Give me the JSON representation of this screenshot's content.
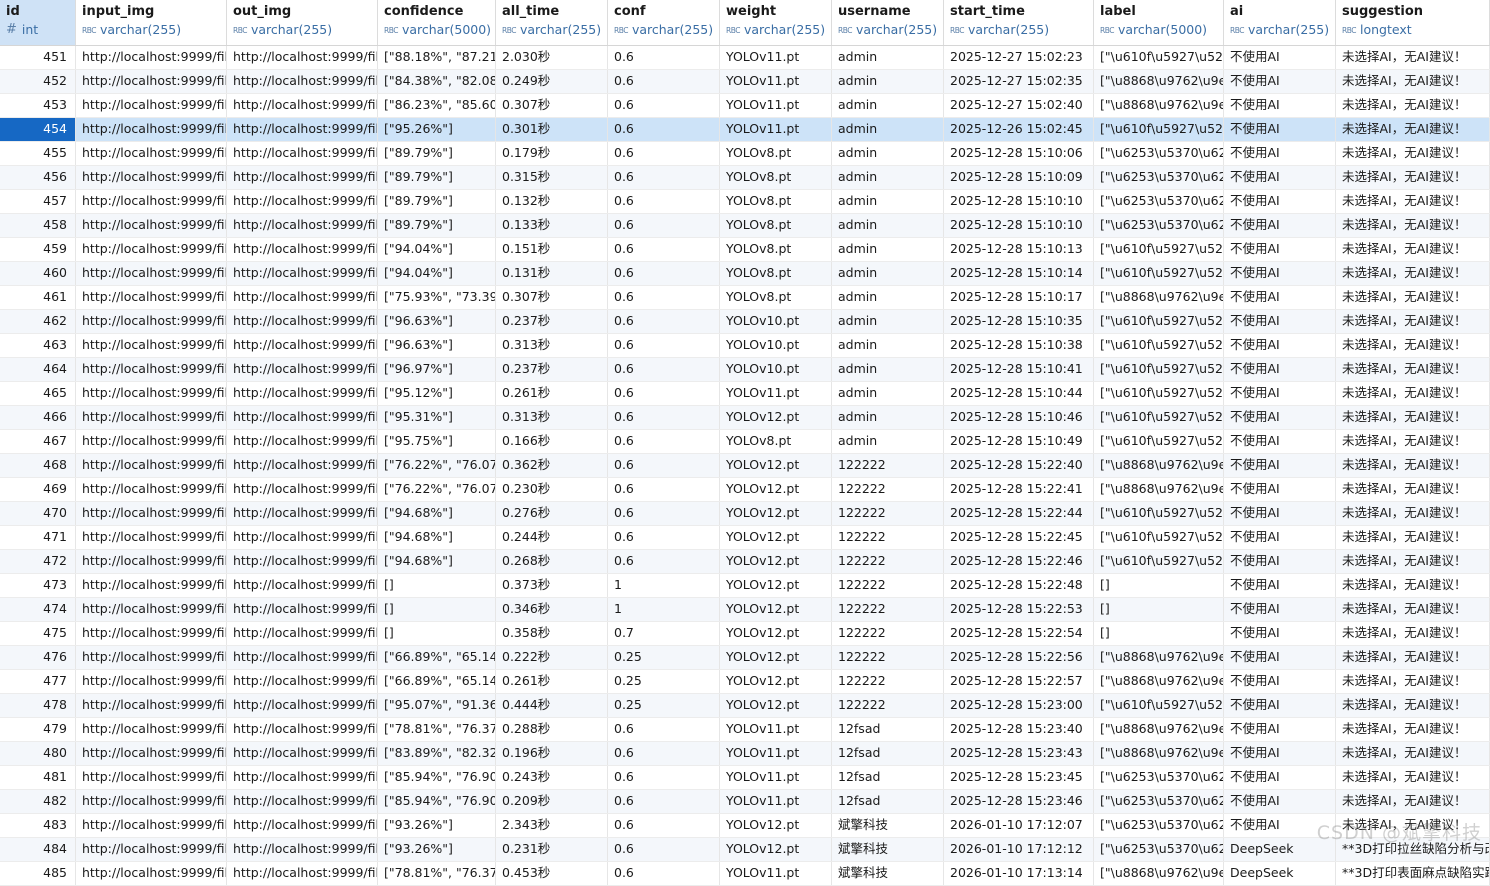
{
  "columns": [
    {
      "name": "id",
      "type": "int",
      "icon": "hash-icon"
    },
    {
      "name": "input_img",
      "type": "varchar(255)",
      "icon": "abc-icon"
    },
    {
      "name": "out_img",
      "type": "varchar(255)",
      "icon": "abc-icon"
    },
    {
      "name": "confidence",
      "type": "varchar(5000)",
      "icon": "abc-icon"
    },
    {
      "name": "all_time",
      "type": "varchar(255)",
      "icon": "abc-icon"
    },
    {
      "name": "conf",
      "type": "varchar(255)",
      "icon": "abc-icon"
    },
    {
      "name": "weight",
      "type": "varchar(255)",
      "icon": "abc-icon"
    },
    {
      "name": "username",
      "type": "varchar(255)",
      "icon": "abc-icon"
    },
    {
      "name": "start_time",
      "type": "varchar(255)",
      "icon": "abc-icon"
    },
    {
      "name": "label",
      "type": "varchar(5000)",
      "icon": "abc-icon"
    },
    {
      "name": "ai",
      "type": "varchar(255)",
      "icon": "abc-icon"
    },
    {
      "name": "suggestion",
      "type": "longtext",
      "icon": "abc-icon"
    }
  ],
  "type_icon_text": "RBC",
  "selected_row": 3,
  "rows": [
    [
      "451",
      "http://localhost:9999/file",
      "http://localhost:9999/file",
      "[\"88.18%\", \"87.21%",
      "2.030秒",
      "0.6",
      "YOLOv11.pt",
      "admin",
      "2025-12-27 15:02:23",
      "[\"\\u610f\\u5927\\u522",
      "不使用AI",
      "未选择AI，无AI建议！"
    ],
    [
      "452",
      "http://localhost:9999/file",
      "http://localhost:9999/file",
      "[\"84.38%\", \"82.08%",
      "0.249秒",
      "0.6",
      "YOLOv11.pt",
      "admin",
      "2025-12-27 15:02:35",
      "[\"\\u8868\\u9762\\u9el",
      "不使用AI",
      "未选择AI，无AI建议！"
    ],
    [
      "453",
      "http://localhost:9999/file",
      "http://localhost:9999/file",
      "[\"86.23%\", \"85.60%",
      "0.307秒",
      "0.6",
      "YOLOv11.pt",
      "admin",
      "2025-12-27 15:02:40",
      "[\"\\u8868\\u9762\\u9el",
      "不使用AI",
      "未选择AI，无AI建议！"
    ],
    [
      "454",
      "http://localhost:9999/file",
      "http://localhost:9999/file",
      "[\"95.26%\"]",
      "0.301秒",
      "0.6",
      "YOLOv11.pt",
      "admin",
      "2025-12-26 15:02:45",
      "[\"\\u610f\\u5927\\u522",
      "不使用AI",
      "未选择AI，无AI建议！"
    ],
    [
      "455",
      "http://localhost:9999/file",
      "http://localhost:9999/file",
      "[\"89.79%\"]",
      "0.179秒",
      "0.6",
      "YOLOv8.pt",
      "admin",
      "2025-12-28 15:10:06",
      "[\"\\u6253\\u5370\\u62c",
      "不使用AI",
      "未选择AI，无AI建议！"
    ],
    [
      "456",
      "http://localhost:9999/file",
      "http://localhost:9999/file",
      "[\"89.79%\"]",
      "0.315秒",
      "0.6",
      "YOLOv8.pt",
      "admin",
      "2025-12-28 15:10:09",
      "[\"\\u6253\\u5370\\u62c",
      "不使用AI",
      "未选择AI，无AI建议！"
    ],
    [
      "457",
      "http://localhost:9999/file",
      "http://localhost:9999/file",
      "[\"89.79%\"]",
      "0.132秒",
      "0.6",
      "YOLOv8.pt",
      "admin",
      "2025-12-28 15:10:10",
      "[\"\\u6253\\u5370\\u62c",
      "不使用AI",
      "未选择AI，无AI建议！"
    ],
    [
      "458",
      "http://localhost:9999/file",
      "http://localhost:9999/file",
      "[\"89.79%\"]",
      "0.133秒",
      "0.6",
      "YOLOv8.pt",
      "admin",
      "2025-12-28 15:10:10",
      "[\"\\u6253\\u5370\\u62c",
      "不使用AI",
      "未选择AI，无AI建议！"
    ],
    [
      "459",
      "http://localhost:9999/file",
      "http://localhost:9999/file",
      "[\"94.04%\"]",
      "0.151秒",
      "0.6",
      "YOLOv8.pt",
      "admin",
      "2025-12-28 15:10:13",
      "[\"\\u610f\\u5927\\u522",
      "不使用AI",
      "未选择AI，无AI建议！"
    ],
    [
      "460",
      "http://localhost:9999/file",
      "http://localhost:9999/file",
      "[\"94.04%\"]",
      "0.131秒",
      "0.6",
      "YOLOv8.pt",
      "admin",
      "2025-12-28 15:10:14",
      "[\"\\u610f\\u5927\\u522",
      "不使用AI",
      "未选择AI，无AI建议！"
    ],
    [
      "461",
      "http://localhost:9999/file",
      "http://localhost:9999/file",
      "[\"75.93%\", \"73.39%",
      "0.307秒",
      "0.6",
      "YOLOv8.pt",
      "admin",
      "2025-12-28 15:10:17",
      "[\"\\u8868\\u9762\\u9el",
      "不使用AI",
      "未选择AI，无AI建议！"
    ],
    [
      "462",
      "http://localhost:9999/file",
      "http://localhost:9999/file",
      "[\"96.63%\"]",
      "0.237秒",
      "0.6",
      "YOLOv10.pt",
      "admin",
      "2025-12-28 15:10:35",
      "[\"\\u610f\\u5927\\u522",
      "不使用AI",
      "未选择AI，无AI建议！"
    ],
    [
      "463",
      "http://localhost:9999/file",
      "http://localhost:9999/file",
      "[\"96.63%\"]",
      "0.313秒",
      "0.6",
      "YOLOv10.pt",
      "admin",
      "2025-12-28 15:10:38",
      "[\"\\u610f\\u5927\\u522",
      "不使用AI",
      "未选择AI，无AI建议！"
    ],
    [
      "464",
      "http://localhost:9999/file",
      "http://localhost:9999/file",
      "[\"96.97%\"]",
      "0.237秒",
      "0.6",
      "YOLOv10.pt",
      "admin",
      "2025-12-28 15:10:41",
      "[\"\\u610f\\u5927\\u522",
      "不使用AI",
      "未选择AI，无AI建议！"
    ],
    [
      "465",
      "http://localhost:9999/file",
      "http://localhost:9999/file",
      "[\"95.12%\"]",
      "0.261秒",
      "0.6",
      "YOLOv11.pt",
      "admin",
      "2025-12-28 15:10:44",
      "[\"\\u610f\\u5927\\u522",
      "不使用AI",
      "未选择AI，无AI建议！"
    ],
    [
      "466",
      "http://localhost:9999/file",
      "http://localhost:9999/file",
      "[\"95.31%\"]",
      "0.313秒",
      "0.6",
      "YOLOv12.pt",
      "admin",
      "2025-12-28 15:10:46",
      "[\"\\u610f\\u5927\\u522",
      "不使用AI",
      "未选择AI，无AI建议！"
    ],
    [
      "467",
      "http://localhost:9999/file",
      "http://localhost:9999/file",
      "[\"95.75%\"]",
      "0.166秒",
      "0.6",
      "YOLOv8.pt",
      "admin",
      "2025-12-28 15:10:49",
      "[\"\\u610f\\u5927\\u522",
      "不使用AI",
      "未选择AI，无AI建议！"
    ],
    [
      "468",
      "http://localhost:9999/file",
      "http://localhost:9999/file",
      "[\"76.22%\", \"76.07%",
      "0.362秒",
      "0.6",
      "YOLOv12.pt",
      "122222",
      "2025-12-28 15:22:40",
      "[\"\\u8868\\u9762\\u9el",
      "不使用AI",
      "未选择AI，无AI建议！"
    ],
    [
      "469",
      "http://localhost:9999/file",
      "http://localhost:9999/file",
      "[\"76.22%\", \"76.07%",
      "0.230秒",
      "0.6",
      "YOLOv12.pt",
      "122222",
      "2025-12-28 15:22:41",
      "[\"\\u8868\\u9762\\u9el",
      "不使用AI",
      "未选择AI，无AI建议！"
    ],
    [
      "470",
      "http://localhost:9999/file",
      "http://localhost:9999/file",
      "[\"94.68%\"]",
      "0.276秒",
      "0.6",
      "YOLOv12.pt",
      "122222",
      "2025-12-28 15:22:44",
      "[\"\\u610f\\u5927\\u522",
      "不使用AI",
      "未选择AI，无AI建议！"
    ],
    [
      "471",
      "http://localhost:9999/file",
      "http://localhost:9999/file",
      "[\"94.68%\"]",
      "0.244秒",
      "0.6",
      "YOLOv12.pt",
      "122222",
      "2025-12-28 15:22:45",
      "[\"\\u610f\\u5927\\u522",
      "不使用AI",
      "未选择AI，无AI建议！"
    ],
    [
      "472",
      "http://localhost:9999/file",
      "http://localhost:9999/file",
      "[\"94.68%\"]",
      "0.268秒",
      "0.6",
      "YOLOv12.pt",
      "122222",
      "2025-12-28 15:22:46",
      "[\"\\u610f\\u5927\\u522",
      "不使用AI",
      "未选择AI，无AI建议！"
    ],
    [
      "473",
      "http://localhost:9999/file",
      "http://localhost:9999/file",
      "[]",
      "0.373秒",
      "1",
      "YOLOv12.pt",
      "122222",
      "2025-12-28 15:22:48",
      "[]",
      "不使用AI",
      "未选择AI，无AI建议！"
    ],
    [
      "474",
      "http://localhost:9999/file",
      "http://localhost:9999/file",
      "[]",
      "0.346秒",
      "1",
      "YOLOv12.pt",
      "122222",
      "2025-12-28 15:22:53",
      "[]",
      "不使用AI",
      "未选择AI，无AI建议！"
    ],
    [
      "475",
      "http://localhost:9999/file",
      "http://localhost:9999/file",
      "[]",
      "0.358秒",
      "0.7",
      "YOLOv12.pt",
      "122222",
      "2025-12-28 15:22:54",
      "[]",
      "不使用AI",
      "未选择AI，无AI建议！"
    ],
    [
      "476",
      "http://localhost:9999/file",
      "http://localhost:9999/file",
      "[\"66.89%\", \"65.14%",
      "0.222秒",
      "0.25",
      "YOLOv12.pt",
      "122222",
      "2025-12-28 15:22:56",
      "[\"\\u8868\\u9762\\u9el",
      "不使用AI",
      "未选择AI，无AI建议！"
    ],
    [
      "477",
      "http://localhost:9999/file",
      "http://localhost:9999/file",
      "[\"66.89%\", \"65.14%",
      "0.261秒",
      "0.25",
      "YOLOv12.pt",
      "122222",
      "2025-12-28 15:22:57",
      "[\"\\u8868\\u9762\\u9el",
      "不使用AI",
      "未选择AI，无AI建议！"
    ],
    [
      "478",
      "http://localhost:9999/file",
      "http://localhost:9999/file",
      "[\"95.07%\", \"91.36%",
      "0.444秒",
      "0.25",
      "YOLOv12.pt",
      "122222",
      "2025-12-28 15:23:00",
      "[\"\\u610f\\u5927\\u522",
      "不使用AI",
      "未选择AI，无AI建议！"
    ],
    [
      "479",
      "http://localhost:9999/file",
      "http://localhost:9999/file",
      "[\"78.81%\", \"76.37%",
      "0.288秒",
      "0.6",
      "YOLOv11.pt",
      "12fsad",
      "2025-12-28 15:23:40",
      "[\"\\u8868\\u9762\\u9el",
      "不使用AI",
      "未选择AI，无AI建议！"
    ],
    [
      "480",
      "http://localhost:9999/file",
      "http://localhost:9999/file",
      "[\"83.89%\", \"82.32%",
      "0.196秒",
      "0.6",
      "YOLOv11.pt",
      "12fsad",
      "2025-12-28 15:23:43",
      "[\"\\u8868\\u9762\\u9el",
      "不使用AI",
      "未选择AI，无AI建议！"
    ],
    [
      "481",
      "http://localhost:9999/file",
      "http://localhost:9999/file",
      "[\"85.94%\", \"76.90%",
      "0.243秒",
      "0.6",
      "YOLOv11.pt",
      "12fsad",
      "2025-12-28 15:23:45",
      "[\"\\u6253\\u5370\\u62c",
      "不使用AI",
      "未选择AI，无AI建议！"
    ],
    [
      "482",
      "http://localhost:9999/file",
      "http://localhost:9999/file",
      "[\"85.94%\", \"76.90%",
      "0.209秒",
      "0.6",
      "YOLOv11.pt",
      "12fsad",
      "2025-12-28 15:23:46",
      "[\"\\u6253\\u5370\\u62c",
      "不使用AI",
      "未选择AI，无AI建议！"
    ],
    [
      "483",
      "http://localhost:9999/file",
      "http://localhost:9999/file",
      "[\"93.26%\"]",
      "2.343秒",
      "0.6",
      "YOLOv12.pt",
      "斌擎科技",
      "2026-01-10 17:12:07",
      "[\"\\u6253\\u5370\\u62c",
      "不使用AI",
      "未选择AI，无AI建议！"
    ],
    [
      "484",
      "http://localhost:9999/file",
      "http://localhost:9999/file",
      "[\"93.26%\"]",
      "0.231秒",
      "0.6",
      "YOLOv12.pt",
      "斌擎科技",
      "2026-01-10 17:12:12",
      "[\"\\u6253\\u5370\\u62c",
      "DeepSeek",
      "**3D打印拉丝缺陷分析与改"
    ],
    [
      "485",
      "http://localhost:9999/file",
      "http://localhost:9999/file",
      "[\"78.81%\", \"76.37%",
      "0.453秒",
      "0.6",
      "YOLOv11.pt",
      "斌擎科技",
      "2026-01-10 17:13:14",
      "[\"\\u8868\\u9762\\u9el",
      "DeepSeek",
      "**3D打印表面麻点缺陷实践"
    ]
  ],
  "watermark": "CSDN @斌擎科技"
}
